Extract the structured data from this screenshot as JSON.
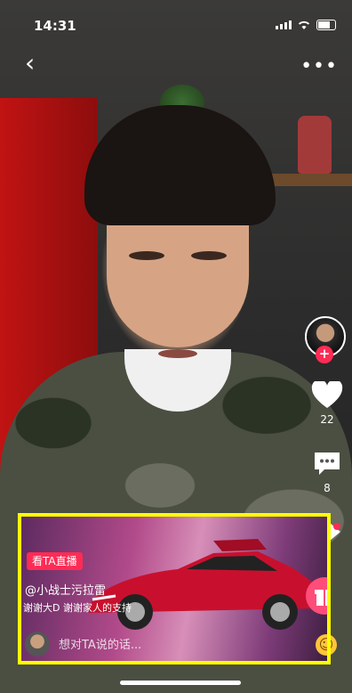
{
  "status_bar": {
    "time": "14:31"
  },
  "nav": {
    "back_glyph": "‹",
    "more_glyph": "•••"
  },
  "rail": {
    "like_count": "22",
    "comment_count": "8"
  },
  "live_card": {
    "live_tag": "看TA直播",
    "streamer": "@小战士污拉雷",
    "description": "谢谢大D  谢谢家人的支持",
    "comment_placeholder": "想对TA说的话..."
  },
  "colors": {
    "accent": "#fe2c55",
    "highlight": "#ffff00",
    "gift": "#ff4d7a",
    "emoji": "#ffc43a"
  }
}
